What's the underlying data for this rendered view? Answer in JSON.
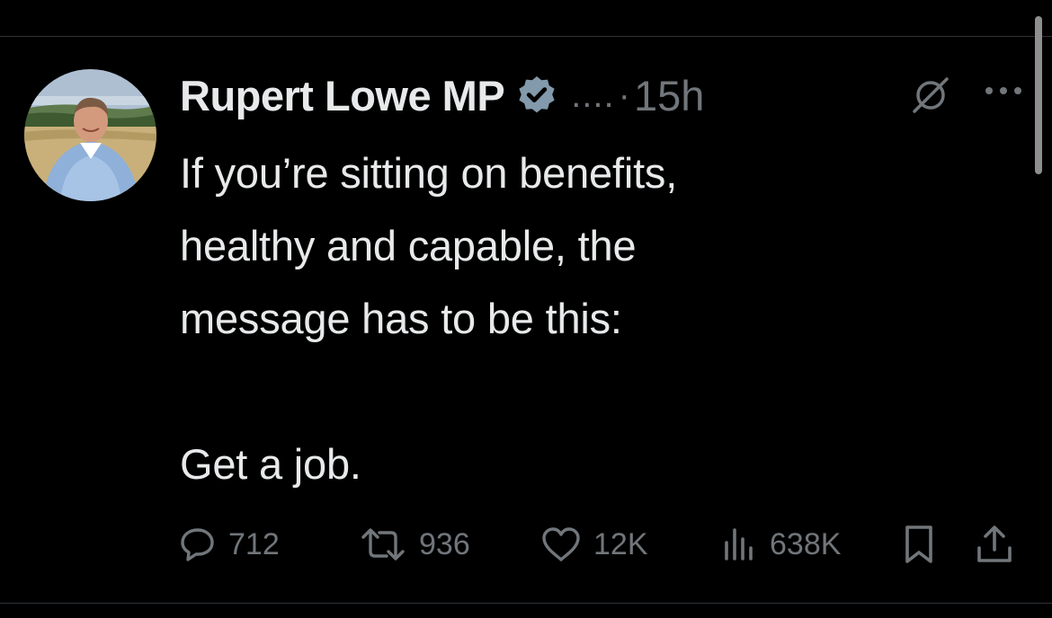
{
  "tweet": {
    "author": {
      "display_name": "Rupert Lowe MP",
      "handle_truncated": "....",
      "verified_color": "#829aab",
      "avatar_icon": "avatar-photo"
    },
    "separator": "·",
    "timestamp": "15h",
    "body_lines": [
      "If you’re sitting on benefits,",
      "healthy and capable, the",
      "message has to be this:",
      "Get a job."
    ],
    "header_icons": [
      "grok-icon",
      "more-icon"
    ],
    "actions": {
      "reply": {
        "icon": "reply-icon",
        "count": "712"
      },
      "retweet": {
        "icon": "retweet-icon",
        "count": "936"
      },
      "like": {
        "icon": "heart-icon",
        "count": "12K"
      },
      "views": {
        "icon": "views-icon",
        "count": "638K"
      },
      "bookmark": {
        "icon": "bookmark-icon"
      },
      "share": {
        "icon": "share-icon"
      }
    }
  },
  "colors": {
    "background": "#000000",
    "primary_text": "#e7e9ea",
    "secondary_text": "#71767b",
    "divider": "#2f3336"
  }
}
